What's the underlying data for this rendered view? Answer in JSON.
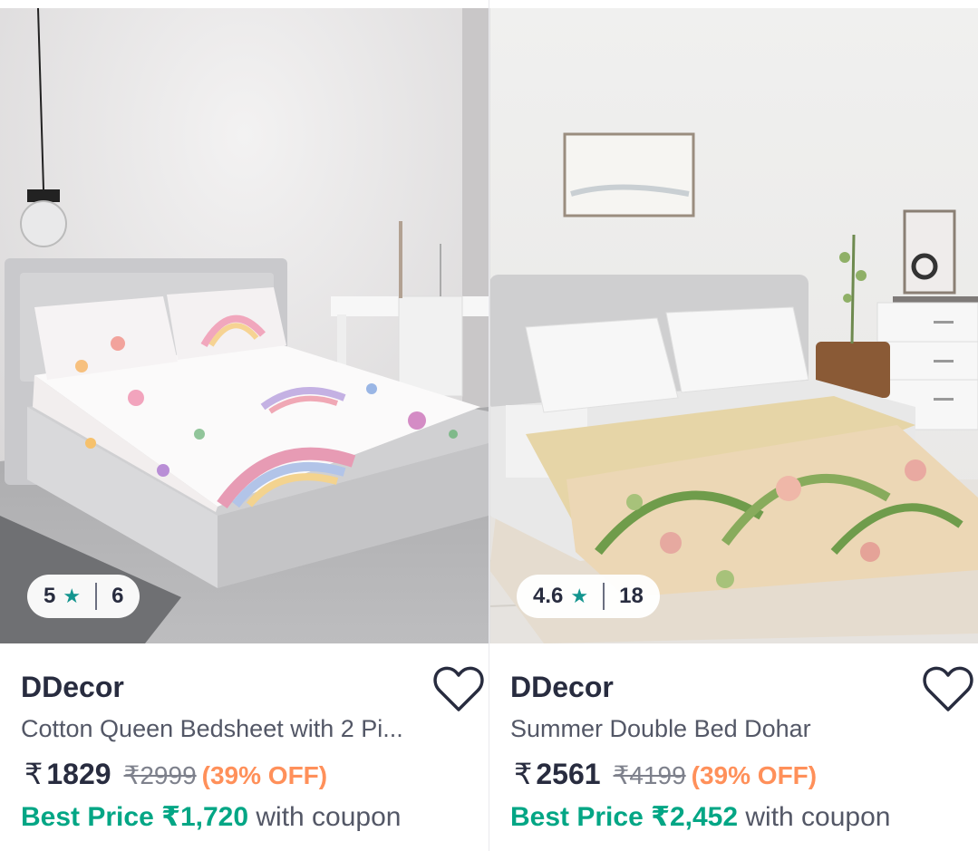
{
  "products": [
    {
      "rating": "5",
      "rating_icon": "star-icon",
      "review_count": "6",
      "brand": "DDecor",
      "title": "Cotton Queen Bedsheet with 2 Pi...",
      "currency": "₹",
      "price": "1829",
      "mrp": "₹2999",
      "discount": "(39% OFF)",
      "best_price_label": "Best Price ₹1,720",
      "coupon_suffix": "with coupon",
      "wishlist_icon": "heart-outline-icon"
    },
    {
      "rating": "4.6",
      "rating_icon": "star-icon",
      "review_count": "18",
      "brand": "DDecor",
      "title": "Summer Double Bed Dohar",
      "currency": "₹",
      "price": "2561",
      "mrp": "₹4199",
      "discount": "(39% OFF)",
      "best_price_label": "Best Price ₹2,452",
      "coupon_suffix": "with coupon",
      "wishlist_icon": "heart-outline-icon"
    }
  ],
  "colors": {
    "star": "#14958f",
    "discount": "#ff905a",
    "best_price": "#03a685",
    "text_primary": "#282c3f",
    "text_secondary": "#535766"
  }
}
